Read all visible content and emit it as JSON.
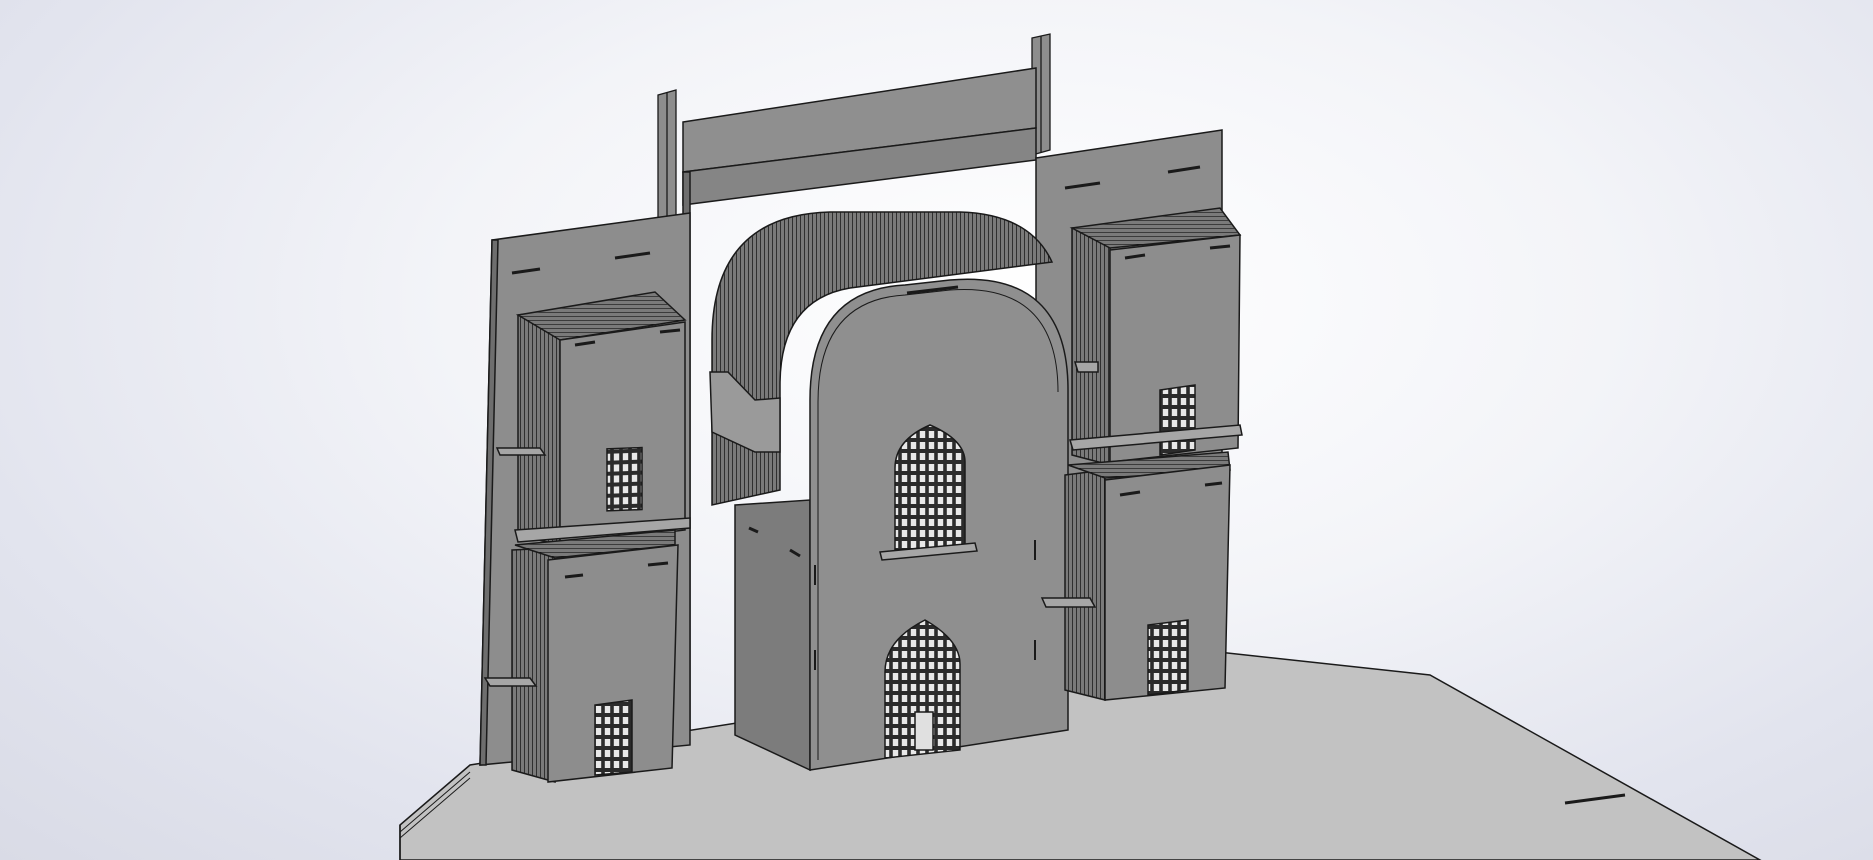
{
  "viewport": {
    "title": "",
    "status": ""
  },
  "colors": {
    "background_center": "#ffffff",
    "background_edge": "#d9dbe6",
    "part_face": "#8d8d8d",
    "part_face_dark": "#6e6e6e",
    "part_face_light": "#a6a6a6",
    "edge_line": "#1a1a1a",
    "base_plate": "#c2c2c2"
  },
  "model": {
    "name": "",
    "components": [
      {
        "name": "base-plate"
      },
      {
        "name": "back-panel-left"
      },
      {
        "name": "back-panel-right"
      },
      {
        "name": "center-tall-panel"
      },
      {
        "name": "vertical-rail-left"
      },
      {
        "name": "vertical-rail-right"
      },
      {
        "name": "arched-central-gate"
      },
      {
        "name": "arched-window-upper"
      },
      {
        "name": "arched-doorway-lower"
      },
      {
        "name": "left-tower-upper"
      },
      {
        "name": "left-tower-lower"
      },
      {
        "name": "right-tower-upper"
      },
      {
        "name": "right-tower-lower"
      }
    ]
  }
}
